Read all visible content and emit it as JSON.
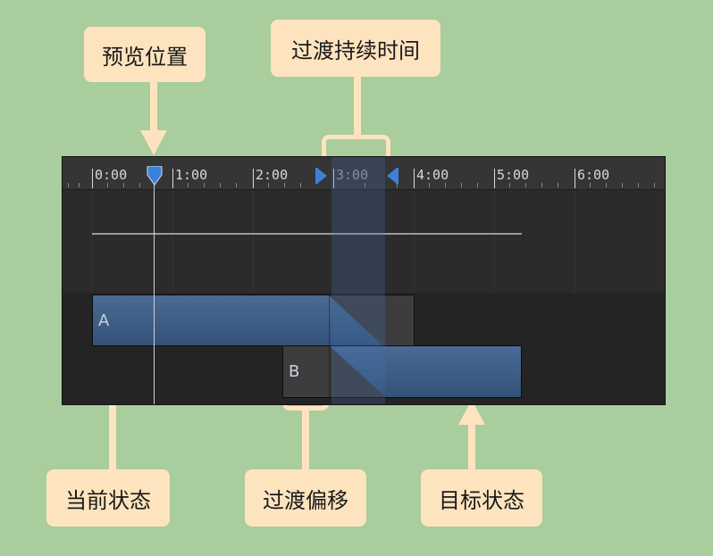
{
  "callouts": {
    "preview_position": "预览位置",
    "transition_duration": "过渡持续时间",
    "current_state": "当前状态",
    "transition_offset": "过渡偏移",
    "target_state": "目标状态"
  },
  "timeline": {
    "ticks": [
      "0:00",
      "1:00",
      "2:00",
      "3:00",
      "4:00",
      "5:00",
      "6:00"
    ],
    "clip_a_label": "A",
    "clip_b_label": "B"
  },
  "colors": {
    "background": "#a9cd9c",
    "callout": "#fde4bf",
    "clip_blue": "#3f5f86",
    "marker_blue": "#3b82d6"
  }
}
